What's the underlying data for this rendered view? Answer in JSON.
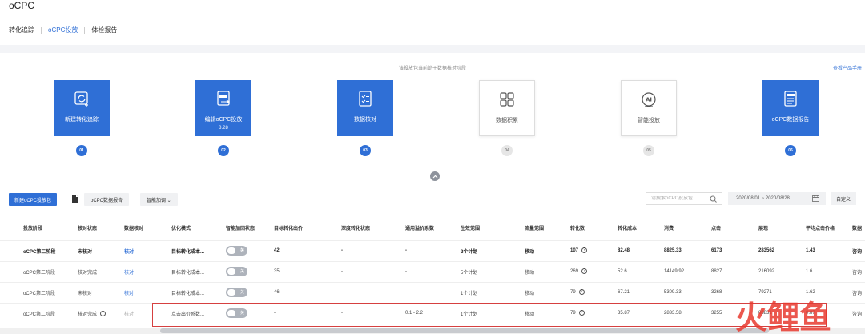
{
  "app": {
    "title": "oCPC"
  },
  "tabs": [
    {
      "label": "转化追踪",
      "active": false
    },
    {
      "label": "oCPC投放",
      "active": true
    },
    {
      "label": "体检报告",
      "active": false
    }
  ],
  "flow": {
    "hint": "该投放包当前处于数据核对阶段",
    "manual_link": "查看产品手册",
    "steps": [
      {
        "num": "01",
        "label": "新建转化追踪",
        "sub": "",
        "active": true,
        "icon": "refresh-plus-icon"
      },
      {
        "num": "02",
        "label": "编辑oCPC投放",
        "sub": "8.28",
        "active": true,
        "icon": "ocpc-edit-icon"
      },
      {
        "num": "03",
        "label": "数据核对",
        "sub": "",
        "active": true,
        "icon": "checklist-icon"
      },
      {
        "num": "04",
        "label": "数据积累",
        "sub": "",
        "active": false,
        "icon": "grid-icon"
      },
      {
        "num": "05",
        "label": "智能投放",
        "sub": "",
        "active": false,
        "icon": "ai-icon"
      },
      {
        "num": "06",
        "label": "oCPC数据报告",
        "sub": "",
        "active": true,
        "icon": "report-icon"
      }
    ]
  },
  "toolbar": {
    "new_button": "新建oCPC投放包",
    "report_button": "oCPC数据报告",
    "smart_button": "智能加调 ⌄",
    "search_placeholder": "请搜索oCPC投放包",
    "date_range": "2020/08/01 ~ 2020/08/28",
    "custom_button": "自定义"
  },
  "table": {
    "headers": [
      "投放阶段",
      "核对状态",
      "数据核对",
      "优化模式",
      "智能加回状态",
      "目标转化出价",
      "深度转化状态",
      "通用溢价系数",
      "生效范围",
      "流量范围",
      "转化数",
      "转化成本",
      "消费",
      "点击",
      "展现",
      "平均点击价格",
      "数据"
    ],
    "toggle_label": "关",
    "rows": [
      [
        "oCPC第二阶段",
        "未核对",
        "核对",
        "目标转化成本...",
        "",
        "42",
        "-",
        "-",
        "2个计划",
        "移动",
        "107",
        "82.48",
        "8825.33",
        "6173",
        "283562",
        "1.43",
        "咨询"
      ],
      [
        "oCPC第二阶段",
        "核对完成",
        "核对",
        "目标转化成本...",
        "",
        "35",
        "-",
        "-",
        "5个计划",
        "移动",
        "269",
        "52.6",
        "14149.92",
        "8827",
        "216092",
        "1.6",
        "咨询"
      ],
      [
        "oCPC第二阶段",
        "未核对",
        "核对",
        "目标转化成本...",
        "",
        "46",
        "-",
        "-",
        "1个计划",
        "移动",
        "79",
        "67.21",
        "5309.33",
        "3268",
        "79271",
        "1.62",
        "咨询"
      ],
      [
        "oCPC第二阶段",
        "核对完成",
        "核对",
        "点击出价系数...",
        "",
        "-",
        "-",
        "0.1 - 2.2",
        "1个计划",
        "移动",
        "79",
        "35.87",
        "2833.58",
        "3255",
        "88831",
        "0.87",
        "咨询"
      ]
    ]
  },
  "watermark": {
    "text": "火鲤鱼"
  },
  "colors": {
    "accent": "#2f6fd6",
    "highlight": "#d64040",
    "watermark": "#e8392f"
  }
}
